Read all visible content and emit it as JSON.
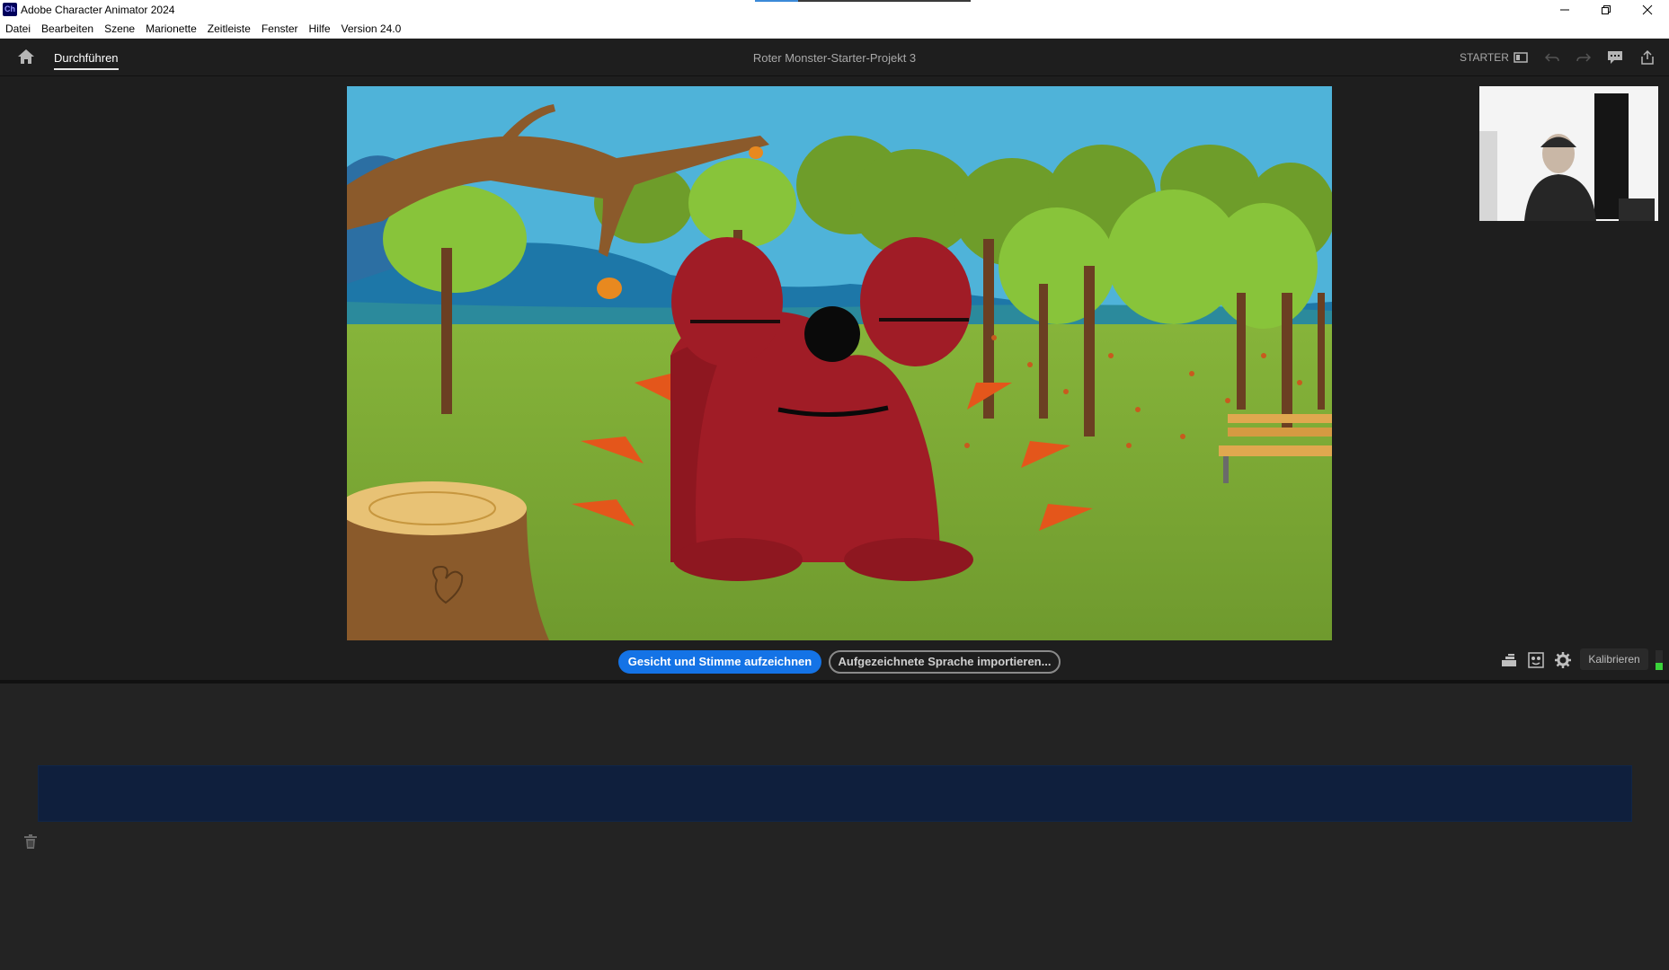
{
  "window": {
    "app_icon_text": "Ch",
    "title": "Adobe Character Animator 2024",
    "minimize_icon": "minimize-icon",
    "restore_icon": "restore-icon",
    "close_icon": "close-icon"
  },
  "menu": {
    "items": [
      "Datei",
      "Bearbeiten",
      "Szene",
      "Marionette",
      "Zeitleiste",
      "Fenster",
      "Hilfe",
      "Version 24.0"
    ]
  },
  "topbar": {
    "home_icon": "home-icon",
    "tab_label": "Durchführen",
    "project_name": "Roter Monster-Starter-Projekt 3",
    "workspace_label": "STARTER",
    "icons": [
      "layout-icon",
      "undo-icon",
      "redo-icon",
      "feedback-icon",
      "share-icon"
    ]
  },
  "controls": {
    "record_label": "Gesicht und Stimme aufzeichnen",
    "import_label": "Aufgezeichnete Sprache importieren...",
    "calibrate_label": "Kalibrieren",
    "icons": [
      "stack-icon",
      "mask-icon",
      "gear-icon"
    ],
    "mic_level": 0.35
  },
  "colors": {
    "accent": "#1473e6",
    "take_bar": "#0f1f3d",
    "mic_level": "#3ad33a"
  }
}
